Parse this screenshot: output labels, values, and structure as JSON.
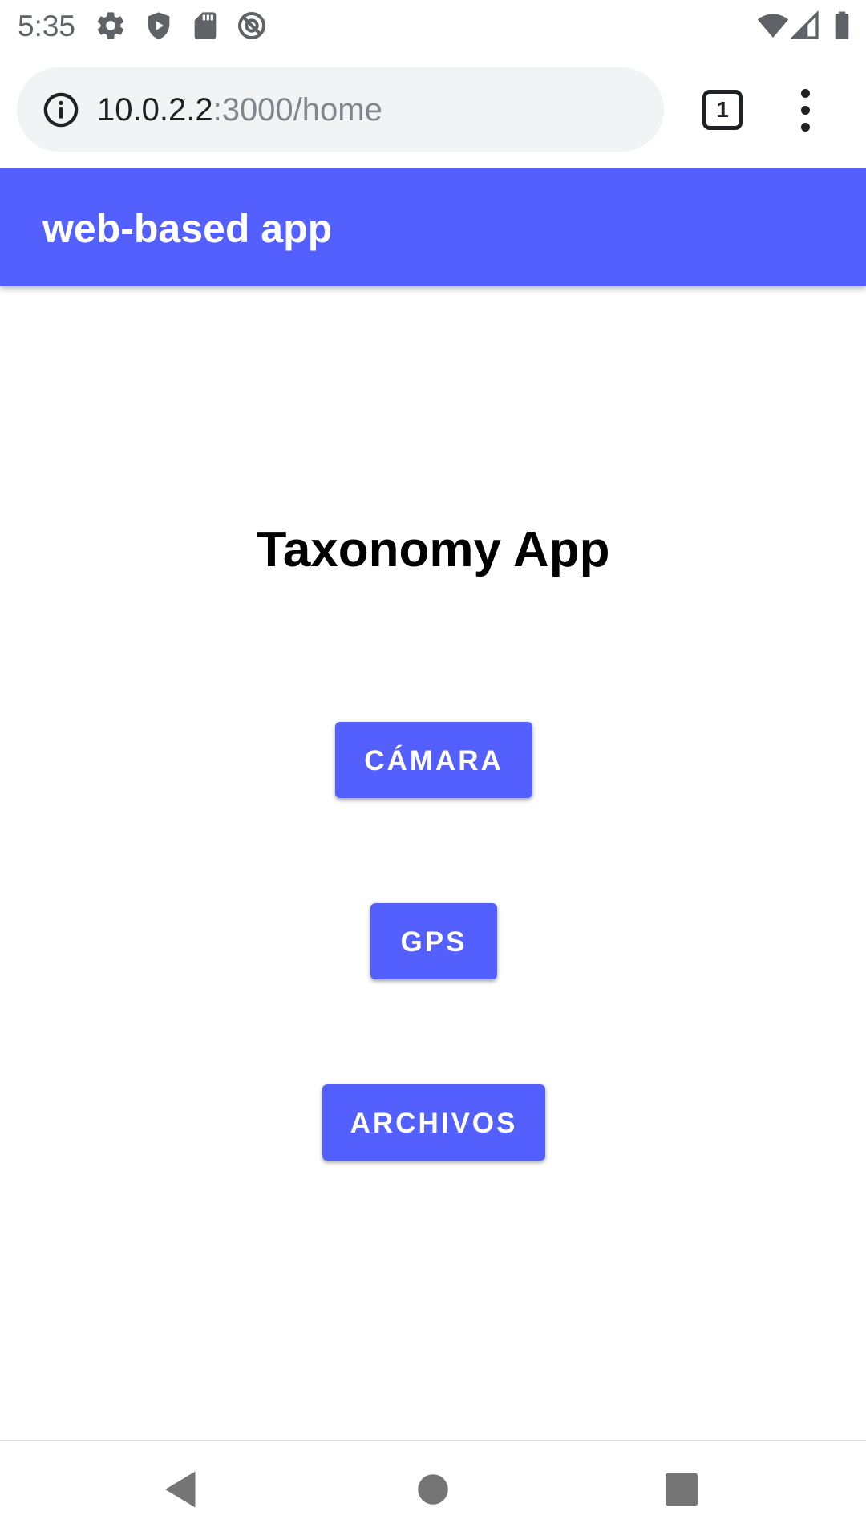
{
  "status_bar": {
    "time": "5:35",
    "left_icons": [
      "settings-icon",
      "shield-icon",
      "sd-card-icon",
      "no-sync-icon"
    ],
    "right_icons": [
      "wifi-icon",
      "cell-signal-icon",
      "battery-icon"
    ]
  },
  "browser": {
    "url_host": "10.0.2.2",
    "url_path": ":3000/home",
    "tab_count": "1",
    "icon_info": "info-icon",
    "icon_menu": "more-vert-icon"
  },
  "app_bar": {
    "title": "web-based app",
    "color": "#5460fe"
  },
  "main": {
    "heading": "Taxonomy App",
    "buttons": [
      {
        "label": "CÁMARA"
      },
      {
        "label": "GPS"
      },
      {
        "label": "ARCHIVOS"
      }
    ]
  },
  "nav_bar": {
    "icons": [
      "back-icon",
      "home-icon",
      "recents-icon"
    ]
  }
}
